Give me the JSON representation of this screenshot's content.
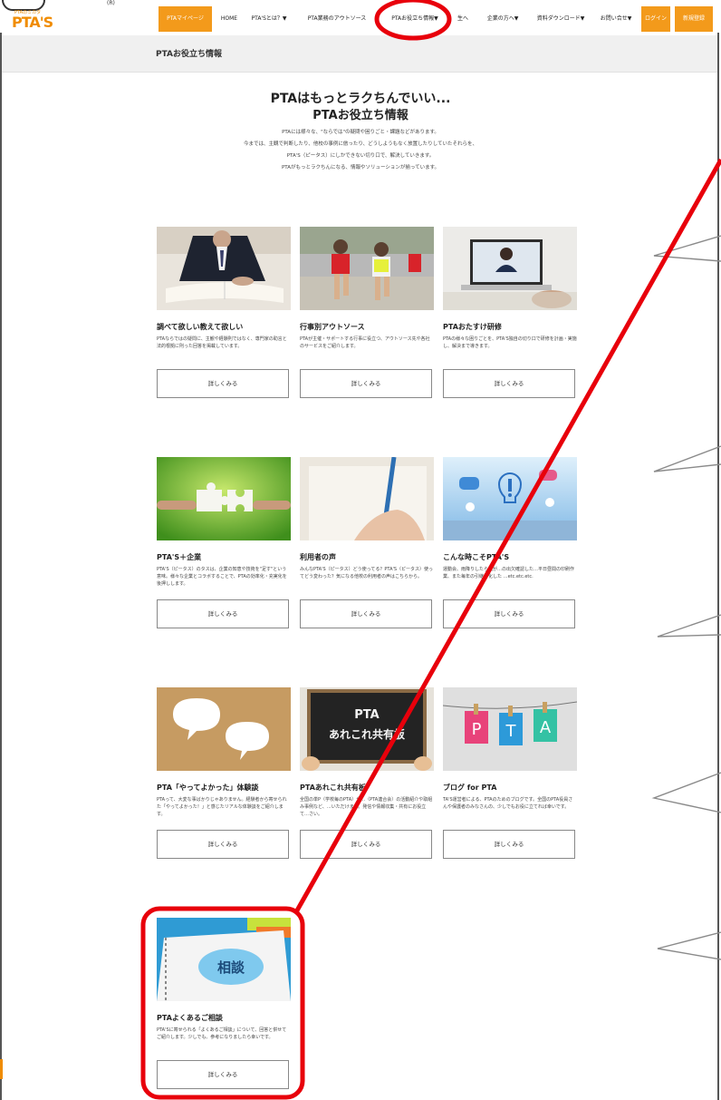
{
  "logo": {
    "small": "PTAのミカタ",
    "big": "PTA'S",
    "reg": "(R)"
  },
  "nav": {
    "mypage": "PTAマイページ",
    "home": "HOME",
    "about": "PTA'Sとは？▼",
    "outsource": "PTA業務のアウトソース",
    "info": "PTAお役立ち情報▼",
    "hidden": "生へ",
    "company": "企業の方へ▼",
    "download": "資料ダウンロード▼",
    "contact": "お問い合せ▼",
    "login": "ログイン",
    "register": "新規登録"
  },
  "breadcrumb": "PTAお役立ち情報",
  "hero": {
    "title1": "PTAはもっとラクちんでいい...",
    "title2": "PTAお役立ち情報",
    "lines": [
      "PTAには様々な、\"ならでは\"の疑問や困りごと・課題などがあります。",
      "今までは、主観で判断したり、他校の事例に倣ったり、どうしようもなく放置したりしていたそれらを、",
      "PTA'S（ピータス）にしかできない切り口で、解決していきます。",
      "PTAがもっとラクちんになる、情報やソリューションが揃っています。"
    ]
  },
  "cards": [
    {
      "title": "調べて欲しい教えて欲しい",
      "desc": "PTAならではの疑問に、主観や経験則ではなく、専門家の助言と法的根拠に則った回答を掲載しています。",
      "button": "詳しくみる"
    },
    {
      "title": "行事別アウトソース",
      "desc": "PTAが主催・サポートする行事に役立つ、アウトソース先や各社のサービスをご紹介します。",
      "button": "詳しくみる"
    },
    {
      "title": "PTAおたすけ研修",
      "desc": "PTAの様々な困りごとを、PTA'S独自の切り口で研修を計画・実施し、解決まで導きます。",
      "button": "詳しくみる"
    },
    {
      "title": "PTA'S＋企業",
      "desc": "PTA'S（ピータス）のタスは、企業の知恵や技術を\"足す\"という意味。様々な企業とコラボすることで、PTAの効率化・充実化を後押しします。",
      "button": "詳しくみる"
    },
    {
      "title": "利用者の声",
      "desc": "みんなPTA'S（ピータス）どう使ってる？PTA'S（ピータス）使ってどう変わった？気になる他校の利用者の声はこちらから。",
      "button": "詳しくみる"
    },
    {
      "title": "こんな時こそPTA'S",
      "desc": "運動会、雨降りしたら我が…の出欠確認した…平日昼間の印刷作業、また毎年の引継ぎ化した …etc.etc.etc.",
      "button": "詳しくみる"
    },
    {
      "title": "PTA「やってよかった」体験談",
      "desc": "PTAって、大変な事ばかりじゃありません。経験者から寄せられた「やってよかった！」と感じたリアルな体験談をご紹介します。",
      "button": "詳しくみる"
    },
    {
      "title": "PTAあれこれ共有板",
      "desc": "全国の単P（学校毎のPTA）や…（PTA連合会）の活動紹介や取組み事例など、…いただけます。発信や情報収集・共有にお役立て…さい。",
      "button": "詳しくみる"
    },
    {
      "title": "ブログ for PTA",
      "desc": "TA'S運営者による、PTAのためのブログです。全国のPTA役員さんや保護者のみなさんの、少しでもお役に立てれば幸いです。",
      "button": "詳しくみる"
    },
    {
      "title": "PTAよくあるご相談",
      "desc": "PTA'Sに寄せられる「よくあるご相談」について、回答と併せてご紹介します。少しでも、参考になりましたら幸いです。",
      "button": "詳しくみる"
    }
  ],
  "image_text": {
    "pta": "PTA",
    "board": "あれこれ共有板",
    "consult": "相談",
    "letters": [
      "P",
      "T",
      "A"
    ]
  },
  "colors": {
    "brand_orange": "#f39a1b",
    "annotation_red": "#e8000b"
  }
}
